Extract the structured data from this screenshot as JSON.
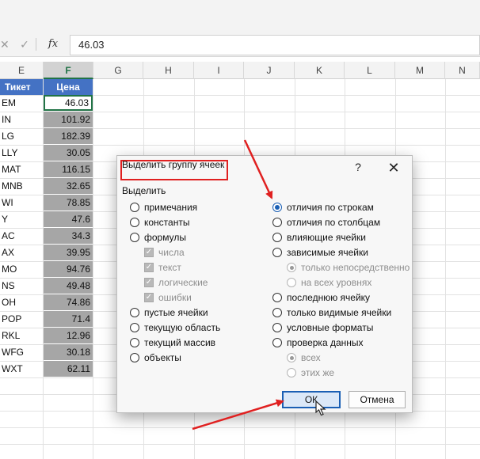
{
  "formula_bar": {
    "cancel_icon": "x-icon",
    "enter_icon": "check-icon",
    "fx_label": "fx",
    "value": "46.03"
  },
  "columns": [
    "E",
    "F",
    "G",
    "H",
    "I",
    "J",
    "K",
    "L",
    "M",
    "N"
  ],
  "selected_column": "F",
  "table": {
    "headers": [
      "Тикет",
      "Цена"
    ],
    "rows": [
      [
        "EM",
        "46.03"
      ],
      [
        "IN",
        "101.92"
      ],
      [
        "LG",
        "182.39"
      ],
      [
        "LLY",
        "30.05"
      ],
      [
        "MAT",
        "116.15"
      ],
      [
        "MNB",
        "32.65"
      ],
      [
        "WI",
        "78.85"
      ],
      [
        "Y",
        "47.6"
      ],
      [
        "AC",
        "34.3"
      ],
      [
        "AX",
        "39.95"
      ],
      [
        "MO",
        "94.76"
      ],
      [
        "NS",
        "49.48"
      ],
      [
        "OH",
        "74.86"
      ],
      [
        "POP",
        "71.4"
      ],
      [
        "RKL",
        "12.96"
      ],
      [
        "WFG",
        "30.18"
      ],
      [
        "WXT",
        "62.11"
      ]
    ]
  },
  "dialog": {
    "title": "Выделить группу ячеек",
    "help_label": "?",
    "close_icon": "close-icon",
    "group_label": "Выделить",
    "left_options": [
      {
        "label": "примечания",
        "kind": "radio",
        "state": "off"
      },
      {
        "label": "константы",
        "kind": "radio",
        "state": "off"
      },
      {
        "label": "формулы",
        "kind": "radio",
        "state": "off"
      },
      {
        "label": "числа",
        "kind": "check",
        "state": "disabled"
      },
      {
        "label": "текст",
        "kind": "check",
        "state": "disabled"
      },
      {
        "label": "логические",
        "kind": "check",
        "state": "disabled"
      },
      {
        "label": "ошибки",
        "kind": "check",
        "state": "disabled"
      },
      {
        "label": "пустые ячейки",
        "kind": "radio",
        "state": "off"
      },
      {
        "label": "текущую область",
        "kind": "radio",
        "state": "off"
      },
      {
        "label": "текущий массив",
        "kind": "radio",
        "state": "off"
      },
      {
        "label": "объекты",
        "kind": "radio",
        "state": "off"
      }
    ],
    "right_options": [
      {
        "label": "отличия по строкам",
        "kind": "radio",
        "state": "on"
      },
      {
        "label": "отличия по столбцам",
        "kind": "radio",
        "state": "off"
      },
      {
        "label": "влияющие ячейки",
        "kind": "radio",
        "state": "off"
      },
      {
        "label": "зависимые ячейки",
        "kind": "radio",
        "state": "off"
      },
      {
        "label": "только непосредственно",
        "kind": "radio",
        "state": "disabled-on"
      },
      {
        "label": "на всех уровнях",
        "kind": "radio",
        "state": "disabled"
      },
      {
        "label": "последнюю ячейку",
        "kind": "radio",
        "state": "off"
      },
      {
        "label": "только видимые ячейки",
        "kind": "radio",
        "state": "off"
      },
      {
        "label": "условные форматы",
        "kind": "radio",
        "state": "off"
      },
      {
        "label": "проверка данных",
        "kind": "radio",
        "state": "off"
      },
      {
        "label": "всех",
        "kind": "radio",
        "state": "disabled-on"
      },
      {
        "label": "этих же",
        "kind": "radio",
        "state": "disabled"
      }
    ],
    "ok_label": "ОК",
    "cancel_label": "Отмена"
  },
  "colors": {
    "header_blue": "#4472c4",
    "selection_gray": "#a6a6a6",
    "excel_green": "#217346",
    "annotation_red": "#e02020",
    "radio_blue": "#1a5fb4"
  }
}
